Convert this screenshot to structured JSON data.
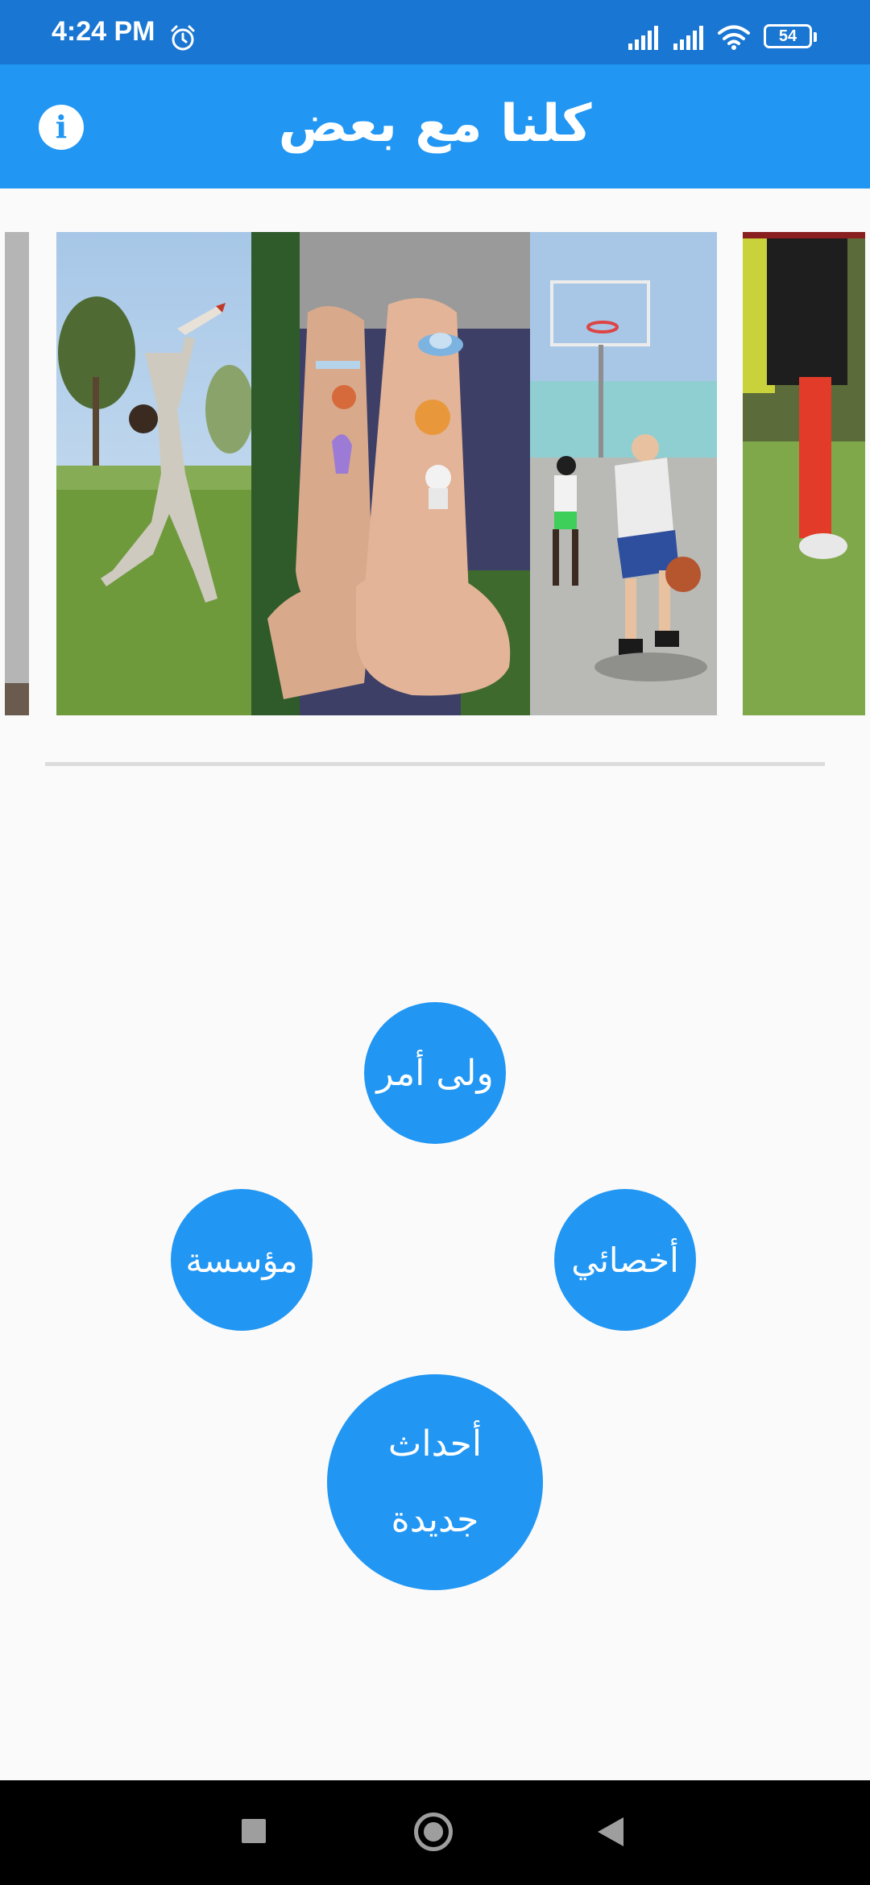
{
  "status_bar": {
    "time": "4:24 PM",
    "battery": "54",
    "icons": [
      "alarm-icon",
      "signal-icon",
      "signal-icon",
      "wifi-icon",
      "battery-icon"
    ]
  },
  "app_bar": {
    "title": "كلنا مع بعض",
    "info_icon": "info-icon",
    "info_glyph": "i"
  },
  "carousel": {
    "slides": [
      "kid-with-toy-rocket-photo",
      "arms-with-space-tattoos-photo",
      "kids-playing-basketball-photo",
      "runner-legs-photo"
    ]
  },
  "menu": {
    "guardian": "ولى أمر",
    "institution": "مؤسسة",
    "specialist": "أخصائي",
    "new_events_line1": "أحداث",
    "new_events_line2": "جديدة"
  },
  "colors": {
    "status_bar": "#1976d2",
    "primary": "#2196f3",
    "background": "#fafafa"
  }
}
